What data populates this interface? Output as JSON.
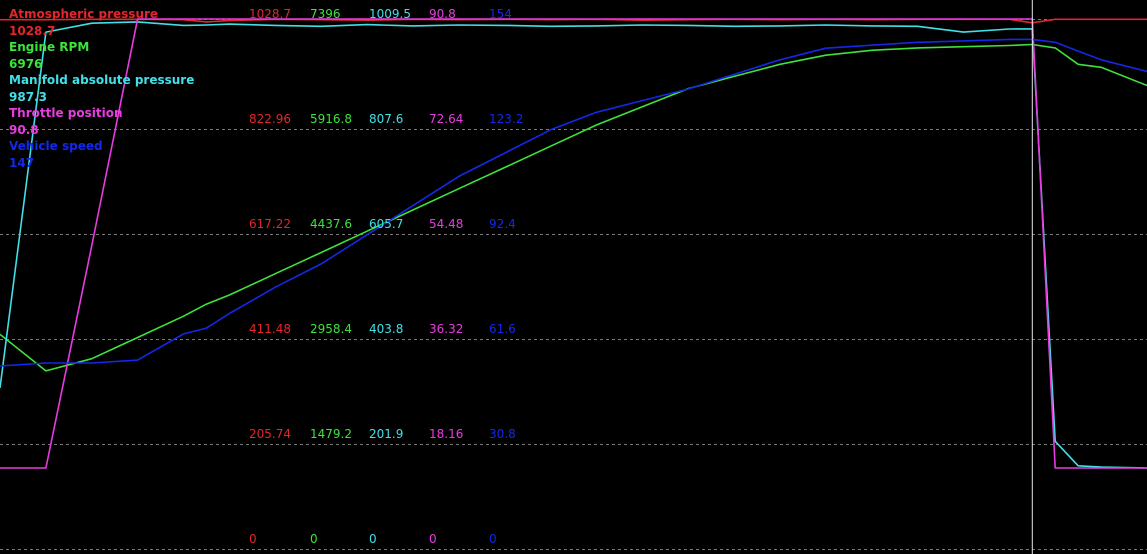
{
  "colors": {
    "background": "#000000",
    "grid": "#7a7a7a",
    "cursor": "#e8e8e8",
    "atmospheric_pressure": "#e2262b",
    "engine_rpm": "#3ee23c",
    "manifold_absolute_pressure": "#40e0e8",
    "throttle_position": "#e83ce0",
    "vehicle_speed": "#1428e8"
  },
  "legend": [
    {
      "key": "atmospheric_pressure",
      "name": "Atmospheric pressure",
      "value": "1028.7"
    },
    {
      "key": "engine_rpm",
      "name": "Engine RPM",
      "value": "6976"
    },
    {
      "key": "manifold_absolute_pressure",
      "name": "Manifold absolute pressure",
      "value": "987.3"
    },
    {
      "key": "throttle_position",
      "name": "Throttle position",
      "value": "90.8"
    },
    {
      "key": "vehicle_speed",
      "name": "Vehicle speed",
      "value": "147"
    }
  ],
  "scale_rows": [
    [
      "1028.7",
      "7396",
      "1009.5",
      "90.8",
      "154"
    ],
    [
      "822.96",
      "5916.8",
      "807.6",
      "72.64",
      "123.2"
    ],
    [
      "617.22",
      "4437.6",
      "605.7",
      "54.48",
      "92.4"
    ],
    [
      "411.48",
      "2958.4",
      "403.8",
      "36.32",
      "61.6"
    ],
    [
      "205.74",
      "1479.2",
      "201.9",
      "18.16",
      "30.8"
    ],
    [
      "0",
      "0",
      "0",
      "0",
      "0"
    ]
  ],
  "chart_data": {
    "type": "line",
    "x": [
      0,
      4,
      8,
      12,
      16,
      18,
      20,
      24,
      28,
      32,
      36,
      40,
      44,
      48,
      52,
      56,
      60,
      64,
      68,
      72,
      76,
      80,
      84,
      88,
      90,
      92,
      94,
      96,
      100
    ],
    "cursor_x": 90,
    "grid": true,
    "legend_position": "top-left",
    "series": [
      {
        "name": "Atmospheric pressure",
        "key": "atmospheric_pressure",
        "ylim": [
          0,
          1028.7
        ],
        "values": [
          1027,
          1027,
          1028,
          1028,
          1027,
          1022,
          1025,
          1028,
          1027,
          1026,
          1028,
          1027,
          1028,
          1027,
          1028,
          1026,
          1027,
          1028,
          1027,
          1028,
          1027,
          1028,
          1028,
          1028,
          1020,
          1028,
          1028,
          1028,
          1028
        ]
      },
      {
        "name": "Engine RPM",
        "key": "engine_rpm",
        "ylim": [
          0,
          7396
        ],
        "values": [
          2200,
          1600,
          1800,
          2150,
          2500,
          2700,
          2850,
          3200,
          3550,
          3900,
          4250,
          4600,
          4950,
          5300,
          5650,
          5950,
          6250,
          6450,
          6650,
          6800,
          6880,
          6920,
          6940,
          6960,
          6976,
          6920,
          6650,
          6600,
          6300
        ]
      },
      {
        "name": "Manifold absolute pressure",
        "key": "manifold_absolute_pressure",
        "ylim": [
          0,
          1009.5
        ],
        "values": [
          180,
          980,
          1000,
          1003,
          995,
          996,
          998,
          995,
          993,
          997,
          994,
          996,
          995,
          993,
          994,
          996,
          995,
          993,
          994,
          996,
          994,
          993,
          980,
          987,
          987.3,
          60,
          5,
          2,
          0
        ]
      },
      {
        "name": "Throttle position",
        "key": "throttle_position",
        "ylim": [
          0,
          90.8
        ],
        "values": [
          0,
          0,
          45,
          90.8,
          90.8,
          90.8,
          90.8,
          90.8,
          90.8,
          90.8,
          90.8,
          90.8,
          90.8,
          90.8,
          90.8,
          90.8,
          90.8,
          90.8,
          90.8,
          90.8,
          90.8,
          90.8,
          90.8,
          90.8,
          90.8,
          0,
          0,
          0,
          0
        ]
      },
      {
        "name": "Vehicle speed",
        "key": "vehicle_speed",
        "ylim": [
          0,
          154
        ],
        "values": [
          35,
          36,
          36,
          37,
          46,
          48,
          53,
          62,
          70,
          80,
          90,
          100,
          108,
          116,
          122,
          126,
          130,
          135,
          140,
          144,
          145,
          146,
          146.5,
          147,
          147,
          146,
          143,
          140,
          136
        ]
      }
    ]
  }
}
